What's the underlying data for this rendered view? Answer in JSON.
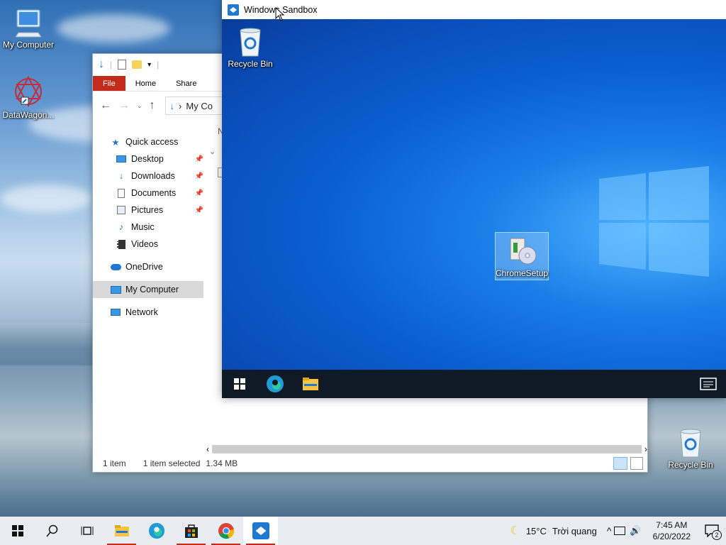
{
  "desktop": {
    "icons": [
      {
        "label": "My Computer"
      },
      {
        "label": "DataWagon..."
      },
      {
        "label": "Recycle Bin"
      }
    ]
  },
  "explorer": {
    "ribbon_tabs": [
      "File",
      "Home",
      "Share"
    ],
    "address_text": "My Co",
    "nav": {
      "quick_access": "Quick access",
      "desktop": "Desktop",
      "downloads": "Downloads",
      "documents": "Documents",
      "pictures": "Pictures",
      "music": "Music",
      "videos": "Videos",
      "onedrive": "OneDrive",
      "my_computer": "My Computer",
      "network": "Network"
    },
    "column_stub": "N",
    "status": {
      "count": "1 item",
      "selected": "1 item selected",
      "size": "1.34 MB"
    }
  },
  "sandbox": {
    "title": "Windows Sandbox",
    "recycle_bin": "Recycle Bin",
    "file_icon": "ChromeSetup"
  },
  "taskbar": {
    "temperature": "15°C",
    "weather": "Trời quang",
    "time": "7:45 AM",
    "date": "6/20/2022",
    "notification_count": "2"
  },
  "colors": {
    "file_tab": "#c42b1c",
    "sandbox_bg": "#0a5fd0",
    "taskbar": "#e9edf1"
  }
}
